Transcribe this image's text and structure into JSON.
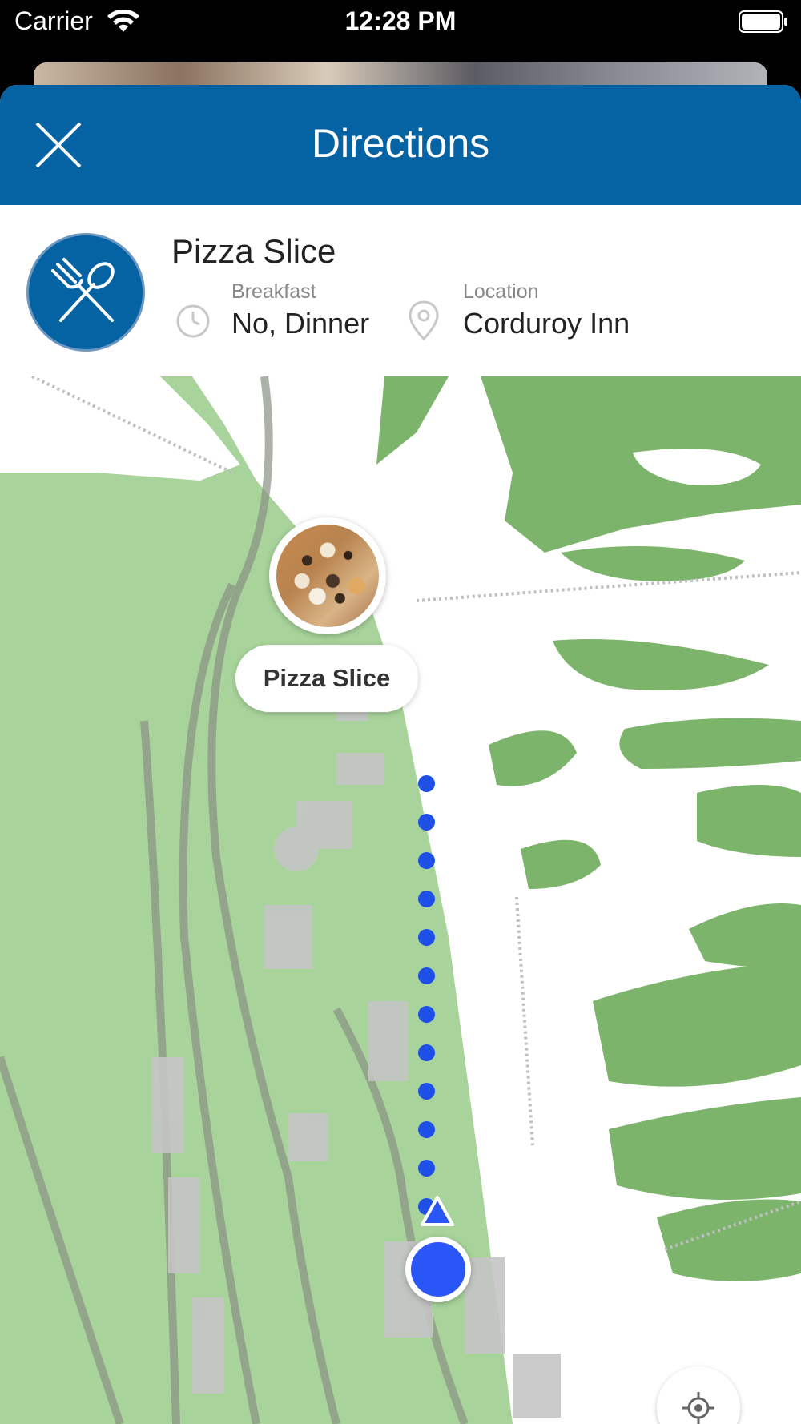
{
  "status_bar": {
    "carrier": "Carrier",
    "time": "12:28 PM",
    "wifi_icon": "wifi-icon",
    "battery_icon": "battery-icon"
  },
  "header": {
    "title": "Directions",
    "close_icon": "close-icon",
    "background_color": "#0562a3"
  },
  "place": {
    "name": "Pizza Slice",
    "avatar_icon": "fork-spoon-icon",
    "meal": {
      "icon": "clock-icon",
      "label": "Breakfast",
      "value": "No, Dinner"
    },
    "location": {
      "icon": "map-pin-icon",
      "label": "Location",
      "value": "Corduroy Inn"
    }
  },
  "map": {
    "destination_label": "Pizza Slice",
    "route_color": "#1e4fe6",
    "user_location_color": "#2a56f7",
    "locate_button_icon": "crosshair-icon",
    "land_color": "#a8d49b",
    "forest_color": "#7cb46b"
  }
}
